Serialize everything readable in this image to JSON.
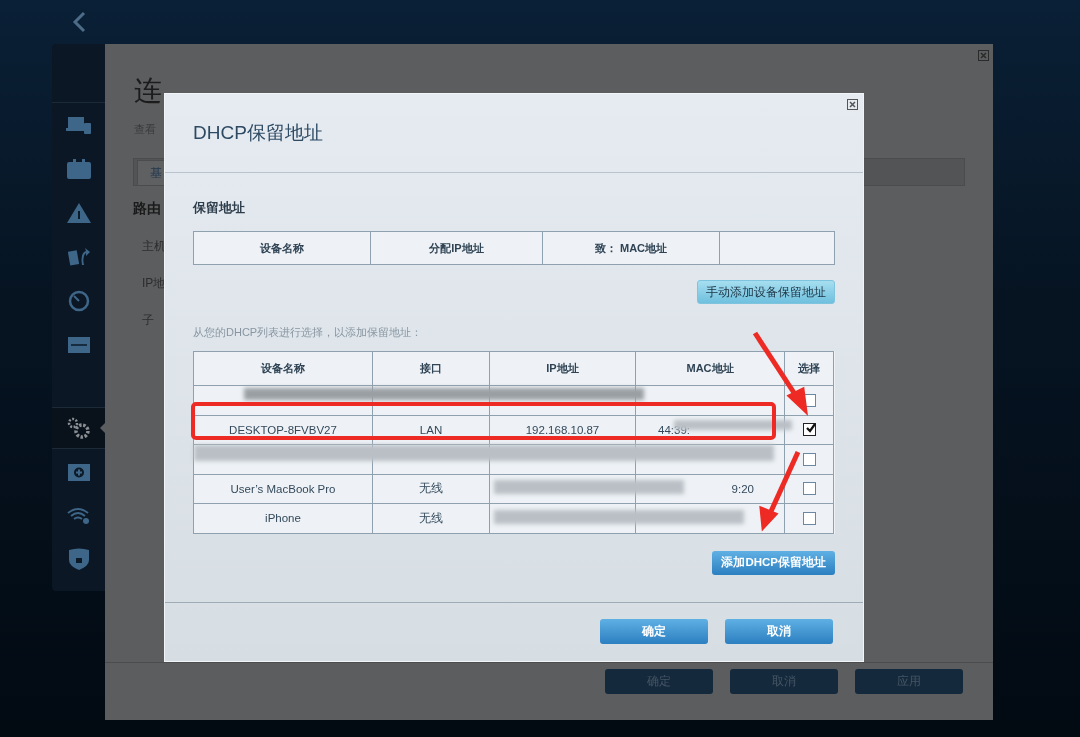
{
  "sidebar": {
    "items": [
      {
        "kind": "devices",
        "selected": false
      },
      {
        "kind": "briefcase",
        "selected": false
      },
      {
        "kind": "warning",
        "selected": false
      },
      {
        "kind": "share",
        "selected": false
      },
      {
        "kind": "gauge",
        "selected": false
      },
      {
        "kind": "usb",
        "selected": false
      },
      {
        "kind": "gears",
        "selected": true
      },
      {
        "kind": "firstaid",
        "selected": false
      },
      {
        "kind": "wifi",
        "selected": false
      },
      {
        "kind": "shield",
        "selected": false
      }
    ]
  },
  "background_page": {
    "title": "连",
    "subtitle": "查看",
    "tab": "基",
    "section": "路由",
    "fields": [
      "主机",
      "IP地",
      "子"
    ],
    "buttons": [
      {
        "label": "确定",
        "disabled": true
      },
      {
        "label": "取消",
        "disabled": true
      },
      {
        "label": "应用",
        "disabled": true
      }
    ]
  },
  "dialog": {
    "title": "DHCP保留地址",
    "section_title": "保留地址",
    "reserved_table": {
      "columns": [
        "设备名称",
        "分配IP地址",
        "致： MAC地址"
      ]
    },
    "manual_add_button": "手动添加设备保留地址",
    "hint": "从您的DHCP列表进行选择，以添加保留地址：",
    "dhcp_table": {
      "columns": [
        "设备名称",
        "接口",
        "IP地址",
        "MAC地址",
        "选择"
      ],
      "rows": [
        {
          "redacted": true,
          "selected": false
        },
        {
          "name": "DESKTOP-8FVBV27",
          "interface": "LAN",
          "ip": "192.168.10.87",
          "mac": "44:39:",
          "redacted": true,
          "selected": true
        },
        {
          "redacted": true,
          "selected": false
        },
        {
          "name": "User’s MacBook Pro",
          "interface": "无线",
          "mac": "9:20",
          "redacted": true,
          "selected": false
        },
        {
          "name": "iPhone",
          "interface": "无线",
          "redacted": true,
          "selected": false
        }
      ]
    },
    "add_button": "添加DHCP保留地址",
    "buttons": [
      {
        "label": "确定"
      },
      {
        "label": "取消"
      }
    ]
  }
}
